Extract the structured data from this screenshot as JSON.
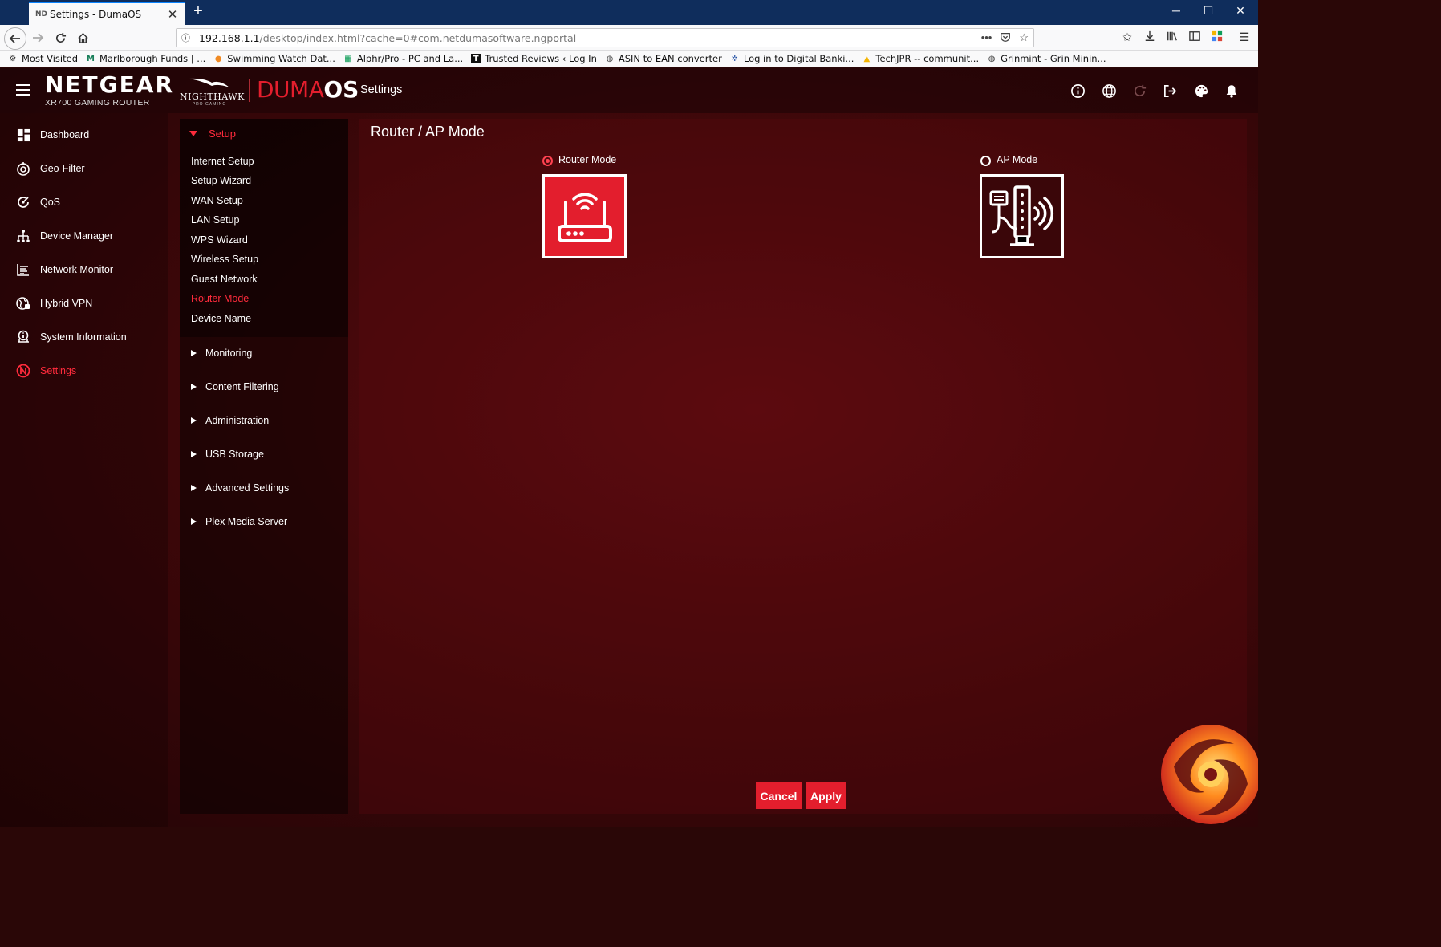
{
  "browser": {
    "tab_favicon": "ND",
    "tab_title": "Settings - DumaOS",
    "tab_close": "✕",
    "new_tab": "+",
    "window_controls": [
      "─",
      "☐",
      "✕"
    ],
    "url_info": "ⓘ",
    "url_host": "192.168.1.1",
    "url_path": "/desktop/index.html?cache=0#com.netdumasoftware.ngportal",
    "bookmarks": [
      {
        "icon": "gear-icon",
        "glyph": "⚙",
        "label": "Most Visited"
      },
      {
        "icon": "m-logo-icon",
        "glyph": "M",
        "label": "Marlborough Funds | ..."
      },
      {
        "icon": "map-pin-icon",
        "glyph": "●",
        "label": "Swimming Watch Dat..."
      },
      {
        "icon": "sheet-icon",
        "glyph": "▦",
        "label": "Alphr/Pro - PC and La..."
      },
      {
        "icon": "t-logo-icon",
        "glyph": "T",
        "label": "Trusted Reviews ‹ Log In"
      },
      {
        "icon": "globe-icon",
        "glyph": "◍",
        "label": "ASIN to EAN converter"
      },
      {
        "icon": "bank-icon",
        "glyph": "✲",
        "label": "Log in to Digital Banki..."
      },
      {
        "icon": "drive-icon",
        "glyph": "▲",
        "label": "TechJPR -- communit..."
      },
      {
        "icon": "globe-icon",
        "glyph": "◍",
        "label": "Grinmint - Grin Minin..."
      }
    ]
  },
  "header": {
    "brand": "NETGEAR",
    "model": "XR700 GAMING ROUTER",
    "nighthawk": "NIGHTHAWK",
    "nighthawk_sub": "PRO GAMING",
    "duma_light": "DUMA",
    "duma_bold": "OS",
    "title": "Settings",
    "icons": [
      "info-icon",
      "globe-icon",
      "refresh-icon",
      "logout-icon",
      "palette-icon",
      "bell-icon"
    ]
  },
  "leftnav": {
    "items": [
      {
        "label": "Dashboard",
        "icon": "dashboard-icon",
        "active": false
      },
      {
        "label": "Geo-Filter",
        "icon": "geo-filter-icon",
        "active": false
      },
      {
        "label": "QoS",
        "icon": "qos-icon",
        "active": false
      },
      {
        "label": "Device Manager",
        "icon": "device-manager-icon",
        "active": false
      },
      {
        "label": "Network Monitor",
        "icon": "network-monitor-icon",
        "active": false
      },
      {
        "label": "Hybrid VPN",
        "icon": "hybrid-vpn-icon",
        "active": false
      },
      {
        "label": "System Information",
        "icon": "system-information-icon",
        "active": false
      },
      {
        "label": "Settings",
        "icon": "settings-icon",
        "active": true
      }
    ]
  },
  "settings_menu": {
    "setup_label": "Setup",
    "setup_items": [
      "Internet Setup",
      "Setup Wizard",
      "WAN Setup",
      "LAN Setup",
      "WPS Wizard",
      "Wireless Setup",
      "Guest Network",
      "Router Mode",
      "Device Name"
    ],
    "active_item": "Router Mode",
    "groups": [
      "Monitoring",
      "Content Filtering",
      "Administration",
      "USB Storage",
      "Advanced Settings",
      "Plex Media Server"
    ]
  },
  "main": {
    "title": "Router / AP Mode",
    "router_mode_label": "Router Mode",
    "ap_mode_label": "AP Mode",
    "selected_mode": "Router Mode",
    "cancel_label": "Cancel",
    "apply_label": "Apply"
  },
  "colors": {
    "accent": "#e31e2d",
    "active_text": "#ff2b3c",
    "background": "#3c0709"
  }
}
